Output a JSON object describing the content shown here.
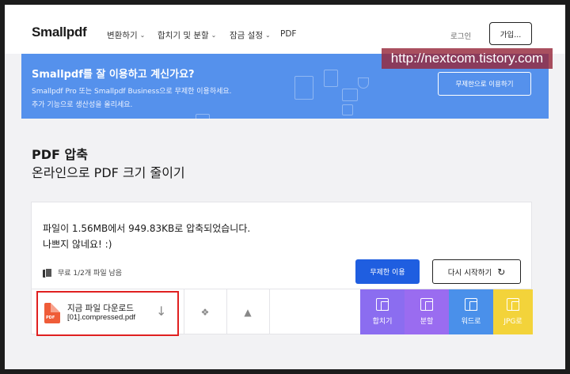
{
  "header": {
    "logo": "Smallpdf",
    "nav": [
      {
        "label": "변환하기"
      },
      {
        "label": "합치기 및 분할"
      },
      {
        "label": "잠금 설정"
      },
      {
        "label": "PDF"
      }
    ],
    "login_label": "로그인",
    "signup_label": "가입..."
  },
  "banner": {
    "title": "Smallpdf를 잘 이용하고 계신가요?",
    "line1": "Smallpdf Pro 또는 Smallpdf Business으로 무제한 이용하세요.",
    "line2": "추가 기능으로 생산성을 올리세요.",
    "button": "무제한으로 이용하기",
    "color": "#5591ec"
  },
  "watermark": "http://nextcom.tistory.com",
  "page": {
    "title": "PDF 압축",
    "subtitle": "온라인으로 PDF 크기 줄이기"
  },
  "result": {
    "message_line1": "파일이 1.56MB에서 949.83KB로 압축되었습니다.",
    "message_line2": "나쁘지 않네요! :)",
    "quota": "무료 1/2개 파일 남음",
    "free_button": "무제한 이용",
    "restart_button": "다시 시작하기",
    "accent_color": "#1f5ee0"
  },
  "download": {
    "title": "지금 파일 다운로드",
    "filename": "[01].compressed.pdf",
    "badge": "PDF"
  },
  "tools": [
    {
      "label": "합치기",
      "color": "#8b6df0"
    },
    {
      "label": "분할",
      "color": "#9a6cf0"
    },
    {
      "label": "워드로",
      "color": "#4a90ea"
    },
    {
      "label": "JPG로",
      "color": "#f3d33a"
    }
  ]
}
